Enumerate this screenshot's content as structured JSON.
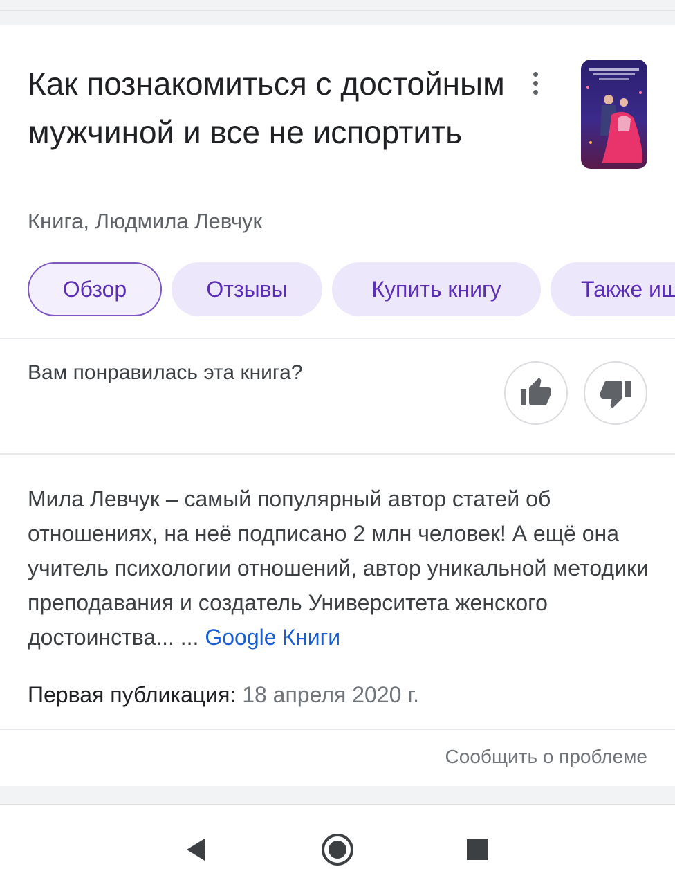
{
  "book": {
    "title": "Как познакомиться с достойным мужчиной и все не испортить",
    "subtitle": "Книга, Людмила Левчук"
  },
  "tabs": [
    {
      "label": "Обзор",
      "active": true
    },
    {
      "label": "Отзывы",
      "active": false
    },
    {
      "label": "Купить книгу",
      "active": false
    },
    {
      "label": "Также ищут",
      "active": false
    }
  ],
  "feedback": {
    "question": "Вам понравилась эта книга?",
    "like_icon": "thumb-up-icon",
    "dislike_icon": "thumb-down-icon"
  },
  "description": {
    "text": "Мила Левчук – самый популярный автор статей об отношениях, на неё подписано 2 млн человек! А ещё она учитель психологии отношений, автор уникальной методики преподавания и создатель Университета женского достоинства... ...",
    "source_link": "Google Книги"
  },
  "publication": {
    "label": "Первая публикация:",
    "value": "18 апреля 2020 г."
  },
  "report_link": "Сообщить о проблеме",
  "colors": {
    "chip_bg": "#ede7fb",
    "chip_text": "#5b2fb5",
    "chip_active_border": "#7e57c2",
    "link": "#1a5fd1"
  },
  "navigation": {
    "back_icon": "back-triangle-icon",
    "home_icon": "home-circle-icon",
    "recents_icon": "recents-square-icon"
  }
}
